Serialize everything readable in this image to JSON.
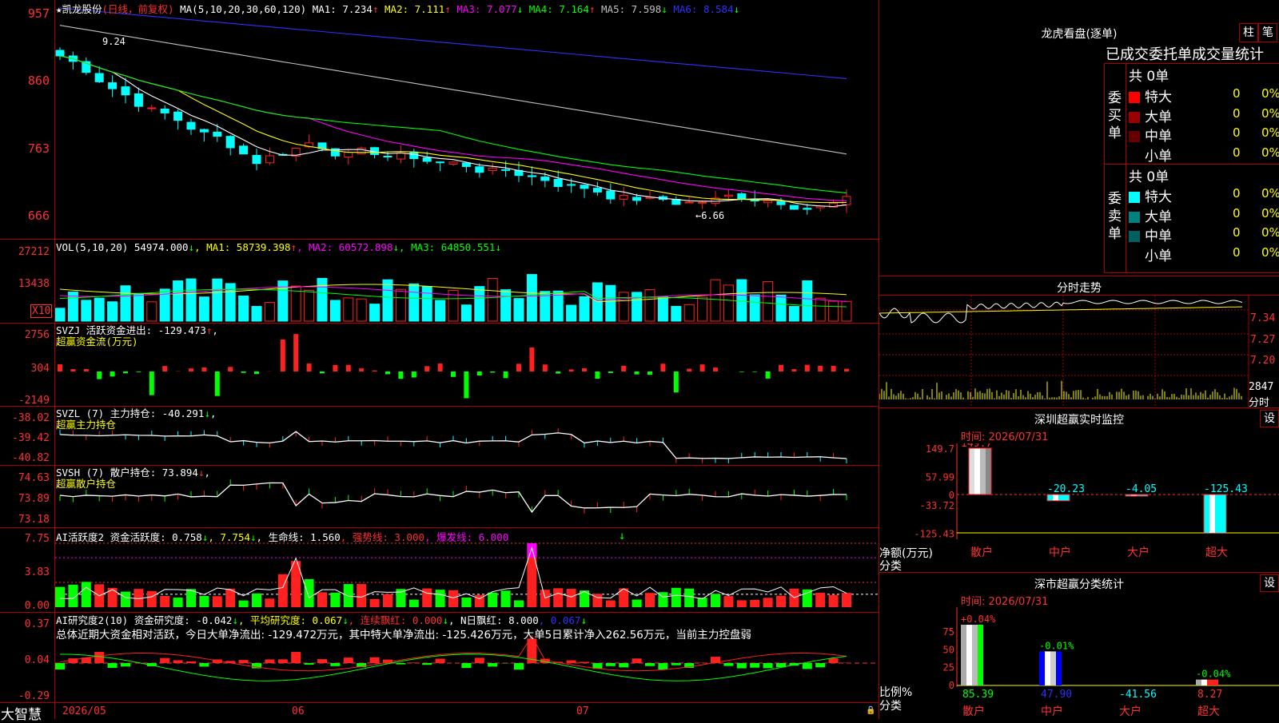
{
  "header": {
    "stock_name": "★凯龙股份",
    "period": "(日线，前复权)",
    "ma_label": "MA(5,10,20,30,60,120)",
    "ma": [
      {
        "label": "MA1:",
        "value": "7.234",
        "arrow": "↑",
        "color": "#ffffff"
      },
      {
        "label": "MA2:",
        "value": "7.111",
        "arrow": "↑",
        "color": "#ffff00"
      },
      {
        "label": "MA3:",
        "value": "7.077",
        "arrow": "↓",
        "color": "#ff00ff"
      },
      {
        "label": "MA4:",
        "value": "7.164",
        "arrow": "↑",
        "color": "#00ff00"
      },
      {
        "label": "MA5:",
        "value": "7.598",
        "arrow": "↓",
        "color": "#c0c0c0"
      },
      {
        "label": "MA6:",
        "value": "8.584",
        "arrow": "↓",
        "color": "#3030ff"
      }
    ],
    "high_mark": "9.24",
    "low_mark": "←6.66"
  },
  "axes": {
    "price": [
      "957",
      "860",
      "763",
      "666"
    ],
    "vol": [
      "27212",
      "13438",
      "X10"
    ],
    "svzj": [
      "2756",
      "304",
      "-2149"
    ],
    "svzl": [
      "-38.02",
      "-39.42",
      "-40.82"
    ],
    "svsh": [
      "74.63",
      "73.89",
      "73.18"
    ],
    "ai1": [
      "7.75",
      "3.83",
      "0.00"
    ],
    "ai2": [
      "0.37",
      "0.04",
      "-0.29"
    ],
    "dates": [
      "2026/05",
      "06",
      "07"
    ]
  },
  "vol_header": {
    "label": "VOL(5,10,20)",
    "value": "54974.000",
    "items": [
      {
        "label": "MA1:",
        "value": "58739.398",
        "arrow": "↑",
        "color": "#ffff00"
      },
      {
        "label": "MA2:",
        "value": "60572.898",
        "arrow": "↓",
        "color": "#ff00ff"
      },
      {
        "label": "MA3:",
        "value": "64850.551",
        "arrow": "↓",
        "color": "#00ff00"
      }
    ]
  },
  "svzj_header": {
    "line1": "SVZJ  活跃资金进出: -129.473",
    "arrow": "↑",
    "line2": "超赢资金流(万元)"
  },
  "svzl_header": {
    "line1": "SVZL (7) 主力持仓: -40.291",
    "arrow": "↓",
    "line2": "超赢主力持仓"
  },
  "svsh_header": {
    "line1": "SVSH (7) 散户持仓: 73.894",
    "arrow": "↓",
    "line2": "超赢散户持仓"
  },
  "ai1_header": {
    "label": "AI活跃度2 资金活跃度: 0.758",
    "a1": "↓",
    "v2": ", 7.754",
    "a2": "↓",
    "v3": ", 生命线: 1.560",
    "strong": ", 强势线: 3.000",
    "burst": ", 爆发线: 6.000"
  },
  "ai2_header": {
    "label": "AI研究度2(10) 资金研究度: -0.042",
    "a1": "↓",
    "avg": ", 平均研究度: 0.067",
    "a2": "↓",
    "cont": ", 连续飘红: 0.000",
    "a3": "↓",
    "nday": ", N日飘红: 8.000",
    "last": ", 0.067",
    "a4": "↓",
    "summary": "总体近期大资金相对活跃，今日大单净流出: -129.472万元，其中特大单净流出: -125.426万元，大单5日累计净入262.56万元，当前主力控盘弱"
  },
  "footer": {
    "brand": "大智慧"
  },
  "lhb": {
    "title": "龙虎看盘(逐单)",
    "btn_zhu": "柱",
    "btn_bi": "笔",
    "stat_title": "已成交委托单成交量统计",
    "buy_label": "委买单",
    "sell_label": "委卖单",
    "buy_total": "共 0单",
    "sell_total": "共 0单",
    "buy_rows": [
      {
        "level": "特大",
        "num": "0",
        "pct": "0%",
        "color": "#ff0000"
      },
      {
        "level": "大单",
        "num": "0",
        "pct": "0%",
        "color": "#990000"
      },
      {
        "level": "中单",
        "num": "0",
        "pct": "0%",
        "color": "#660000"
      },
      {
        "level": "小单",
        "num": "0",
        "pct": "0%",
        "color": "#000000"
      }
    ],
    "sell_rows": [
      {
        "level": "特大",
        "num": "0",
        "pct": "0%",
        "color": "#00ffff"
      },
      {
        "level": "大单",
        "num": "0",
        "pct": "0%",
        "color": "#008080"
      },
      {
        "level": "中单",
        "num": "0",
        "pct": "0%",
        "color": "#006060"
      },
      {
        "level": "小单",
        "num": "0",
        "pct": "0%",
        "color": "#000000"
      }
    ]
  },
  "intraday": {
    "title": "分时走势",
    "prices": [
      "7.34",
      "7.27",
      "7.20"
    ],
    "vol": "2847",
    "vol_label": "分时"
  },
  "monitor": {
    "title": "深圳超赢实时监控",
    "settings": "设",
    "time": "时间: 2026/07/31",
    "y": [
      "149.7",
      "57.99",
      "0",
      "-33.72",
      "-125.43"
    ],
    "unit1": "净额(万元)",
    "unit2": "分类",
    "cats": [
      "散户",
      "中户",
      "大户",
      "超大"
    ],
    "values": [
      149.7,
      -20.23,
      -4.05,
      -125.43
    ],
    "labels": [
      "149.7",
      "-20.23",
      "-4.05",
      "-125.43"
    ]
  },
  "classify": {
    "title": "深市超赢分类统计",
    "settings": "设",
    "time": "时间: 2026/07/31",
    "y": [
      "75",
      "50",
      "25",
      "0"
    ],
    "unit1": "比例%",
    "unit2": "分类",
    "cats": [
      "散户",
      "中户",
      "大户",
      "超大"
    ],
    "values": [
      85.39,
      47.9,
      -41.56,
      8.27
    ],
    "labels": [
      "85.39",
      "47.90",
      "-41.56",
      "8.27"
    ],
    "changes": [
      "+0.04%",
      "-0.01%",
      "",
      "-0.04%"
    ]
  }
}
